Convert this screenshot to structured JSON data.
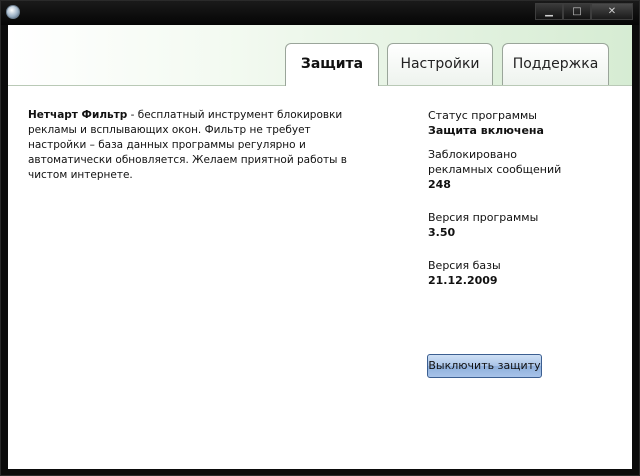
{
  "window": {
    "title": "",
    "controls": {
      "minimize": "▁",
      "maximize": "□",
      "close": "✕"
    }
  },
  "tabs": [
    {
      "label": "Защита",
      "active": true
    },
    {
      "label": "Настройки",
      "active": false
    },
    {
      "label": "Поддержка",
      "active": false
    }
  ],
  "description": {
    "product_name": "Нетчарт Фильтр",
    "text": " - бесплатный инструмент блокировки рекламы и всплывающих окон. Фильтр не требует настройки – база данных программы регулярно и автоматически обновляется. Желаем приятной работы в чистом интернете."
  },
  "status": {
    "program_status_label": "Статус программы",
    "program_status_value": "Защита включена",
    "blocked_label_line1": "Заблокировано",
    "blocked_label_line2": "рекламных сообщений",
    "blocked_value": "248",
    "version_label": "Версия программы",
    "version_value": "3.50",
    "db_version_label": "Версия базы",
    "db_version_value": "21.12.2009"
  },
  "actions": {
    "toggle_protection_label": "Выключить защиту"
  }
}
